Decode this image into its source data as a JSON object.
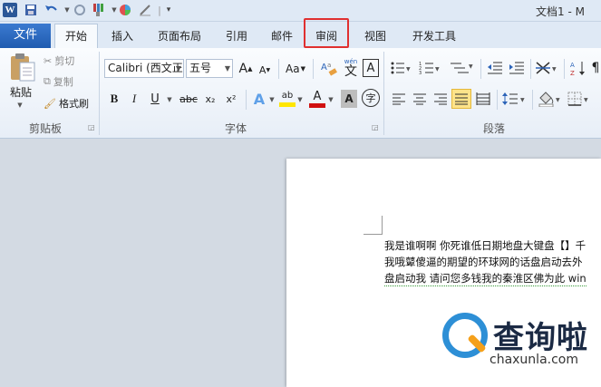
{
  "titlebar": {
    "app_icon": "W",
    "doc_title": "文档1 - M"
  },
  "tabs": {
    "file": "文件",
    "items": [
      "开始",
      "插入",
      "页面布局",
      "引用",
      "邮件",
      "审阅",
      "视图",
      "开发工具"
    ]
  },
  "clipboard": {
    "paste": "粘贴",
    "cut": "剪切",
    "copy": "复制",
    "format_painter": "格式刷",
    "group_label": "剪贴板"
  },
  "font": {
    "font_name": "Calibri (西文正",
    "font_size": "五号",
    "grow": "A",
    "shrink": "A",
    "change_case": "Aa",
    "phonetic": "wén",
    "char_border": "A",
    "bold": "B",
    "italic": "I",
    "underline": "U",
    "strike": "abc",
    "subscript": "x₂",
    "superscript": "x²",
    "text_effect": "A",
    "highlight": "ab",
    "font_color": "A",
    "char_shading": "A",
    "enclose": "字",
    "group_label": "字体"
  },
  "paragraph": {
    "group_label": "段落"
  },
  "document": {
    "lines": [
      "我是谁啊啊  你死谁低日期地盘大键盘【】千",
      "我哦鼙傻逼的期望的环球网的话盘启动去外",
      "盘启动我  请问您多钱我的秦淮区佛为此 win"
    ]
  },
  "watermark": {
    "cn": "查询啦",
    "en": "chaxunla.com"
  },
  "colors": {
    "file_tab": "#2b63b8",
    "highlight_box": "#e03030",
    "highlight_yellow": "#ffe600",
    "font_red": "#d01010"
  }
}
